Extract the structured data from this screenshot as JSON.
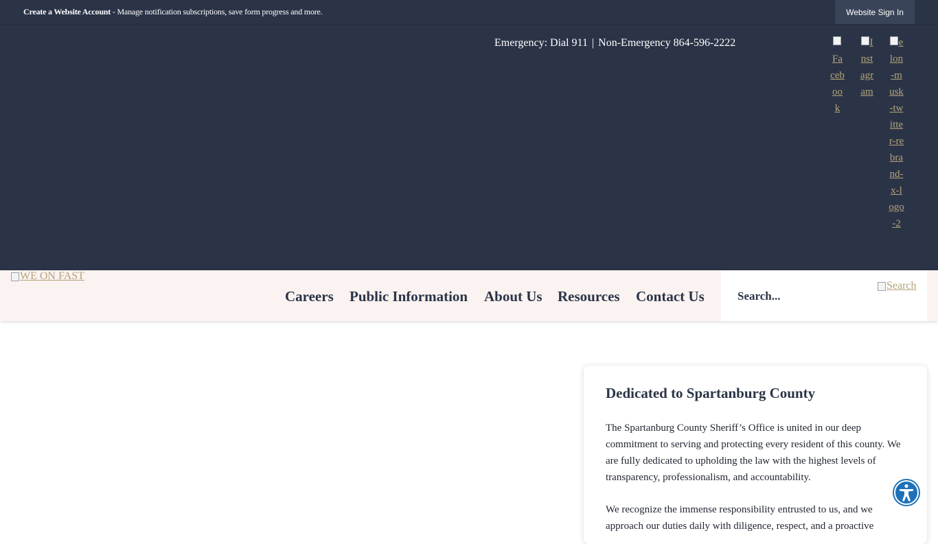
{
  "topbar": {
    "account_link": "Create a Website Account",
    "account_desc": " - Manage notification subscriptions, save form progress and more.",
    "signin_label": "Website Sign In"
  },
  "header": {
    "emergency": "Emergency: Dial 911",
    "separator": "|",
    "non_emergency": "Non-Emergency 864-596-2222",
    "social": [
      {
        "alt": "Facebook",
        "icon": "facebook-icon"
      },
      {
        "alt": "Instagram",
        "icon": "instagram-icon"
      },
      {
        "alt": "elon-musk-twitter-rebrand-x-logo-2",
        "icon": "x-twitter-icon"
      }
    ]
  },
  "nav": {
    "logo_alt": "WE ON FAST",
    "items": [
      "Careers",
      "Public Information",
      "About Us",
      "Resources",
      "Contact Us"
    ],
    "search_placeholder": "Search...",
    "search_button_alt": "Search"
  },
  "card": {
    "title": "Dedicated to Spartanburg County",
    "para1": "The Spartanburg County Sheriff’s Office is united in our deep commitment to serving and protecting every resident of this county. We are fully dedicated to upholding the law with the highest levels of transparency, professionalism, and accountability.",
    "para2": "We recognize the immense responsibility entrusted to us, and we approach our duties daily with diligence, respect, and a proactive"
  },
  "accessibility": {
    "icon": "accessibility-icon"
  },
  "colors": {
    "header_bg": "#2b3447",
    "nav_bg": "#fbf3f1",
    "link": "#b5a37a",
    "accessibility": "#1d71b8"
  }
}
